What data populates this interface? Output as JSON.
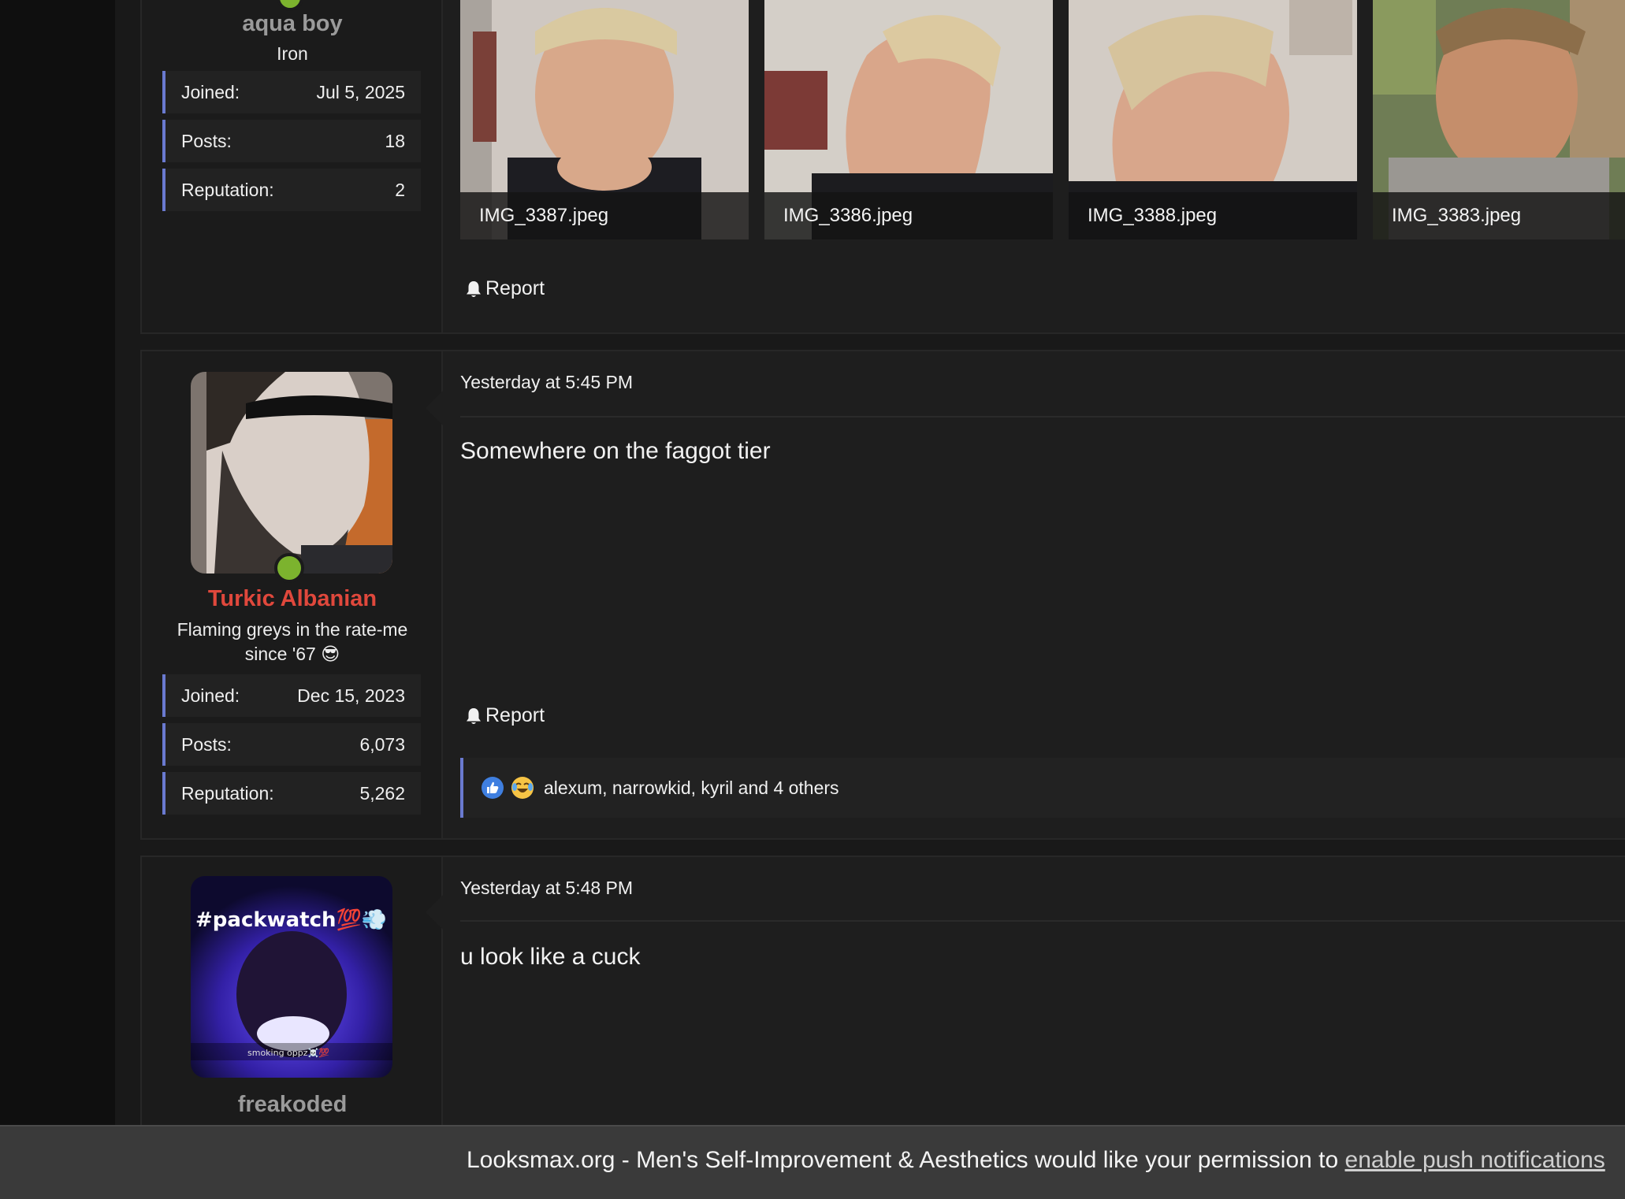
{
  "post1": {
    "username": "aqua boy",
    "title": "Iron",
    "stats": [
      {
        "label": "Joined:",
        "value": "Jul 5, 2025"
      },
      {
        "label": "Posts:",
        "value": "18"
      },
      {
        "label": "Reputation:",
        "value": "2"
      }
    ],
    "attachments": [
      "IMG_3387.jpeg",
      "IMG_3386.jpeg",
      "IMG_3388.jpeg",
      "IMG_3383.jpeg"
    ],
    "report_label": "Report"
  },
  "post2": {
    "username": "Turkic Albanian",
    "username_color": "#e0483c",
    "title": "Flaming greys in the rate-me since '67 😎",
    "stats": [
      {
        "label": "Joined:",
        "value": "Dec 15, 2023"
      },
      {
        "label": "Posts:",
        "value": "6,073"
      },
      {
        "label": "Reputation:",
        "value": "5,262"
      }
    ],
    "date": "Yesterday at 5:45 PM",
    "message": "Somewhere on the faggot tier",
    "report_label": "Report",
    "reactions_text": "alexum, narrowkid, kyril and 4 others",
    "reaction_icons": [
      "like-icon",
      "laugh-cry-icon"
    ]
  },
  "post3": {
    "username": "freakoded",
    "avatar_text": "#packwatch💯💨",
    "avatar_caption": "smoking oppz☠️💯",
    "date": "Yesterday at 5:48 PM",
    "message": "u look like a cuck"
  },
  "notification": {
    "text": "Looksmax.org - Men's Self-Improvement & Aesthetics would like your permission to ",
    "link": "enable push notifications"
  },
  "colors": {
    "accent": "#6a7ad0",
    "online": "#7cb32e",
    "username_gray": "#9a9a9a"
  }
}
